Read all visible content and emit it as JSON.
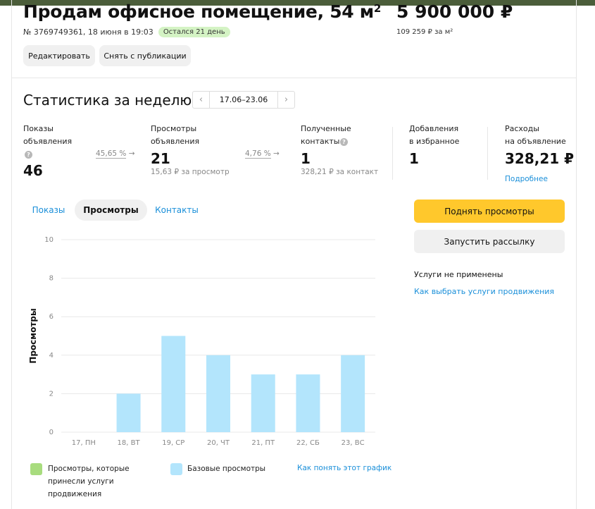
{
  "listing": {
    "title": "Продам офисное помещение, 54 м",
    "title_sup": "2",
    "price": "5 900 000 ₽",
    "meta": "№ 3769749361, 18 июня в 19:03",
    "badge": "Остался 21 день",
    "price_per_m": "109 259 ₽ за м²",
    "edit_label": "Редактировать",
    "unpublish_label": "Снять с публикации"
  },
  "stats": {
    "title": "Статистика за неделю",
    "week_range": "17.06–23.06",
    "prev_icon": "chevron-left-icon",
    "next_icon": "chevron-right-icon",
    "impressions": {
      "label_line1": "Показы",
      "label_line2": "объявления",
      "value": "46"
    },
    "conv1": "45,65 %",
    "views": {
      "label_line1": "Просмотры",
      "label_line2": "объявления",
      "value": "21",
      "sub": "15,63 ₽ за просмотр"
    },
    "conv2": "4,76 %",
    "contacts": {
      "label_line1": "Полученные",
      "label_line2": "контакты",
      "value": "1",
      "sub": "328,21 ₽ за контакт"
    },
    "favorites": {
      "label_line1": "Добавления",
      "label_line2": "в избранное",
      "value": "1"
    },
    "expenses": {
      "label_line1": "Расходы",
      "label_line2": "на объявление",
      "value": "328,21 ₽",
      "link": "Подробнее"
    }
  },
  "tabs": [
    "Показы",
    "Просмотры",
    "Контакты"
  ],
  "active_tab": "Просмотры",
  "actions": {
    "boost_label": "Поднять просмотры",
    "mailing_label": "Запустить рассылку",
    "services_note": "Услуги не применены",
    "services_link": "Как выбрать услуги продвижения"
  },
  "legend": {
    "promo_line1": "Просмотры, которые",
    "promo_line2": "принесли услуги",
    "promo_line3": "продвижения",
    "base": "Базовые просмотры",
    "help_link": "Как понять этот график"
  },
  "colors": {
    "accent": "#ffc82c",
    "link": "#1a8fd9",
    "bar": "#b3e5fc",
    "promo": "#a8dc7e"
  },
  "chart_data": {
    "type": "bar",
    "categories": [
      "17, ПН",
      "18, ВТ",
      "19, СР",
      "20, ЧТ",
      "21, ПТ",
      "22, СБ",
      "23, ВС"
    ],
    "series": [
      {
        "name": "Базовые просмотры",
        "values": [
          0,
          2,
          5,
          4,
          3,
          3,
          4
        ]
      }
    ],
    "ylabel": "Просмотры",
    "ylim": [
      0,
      10
    ],
    "yticks": [
      0,
      2,
      4,
      6,
      8,
      10
    ],
    "grid": true,
    "legend_position": "bottom"
  }
}
